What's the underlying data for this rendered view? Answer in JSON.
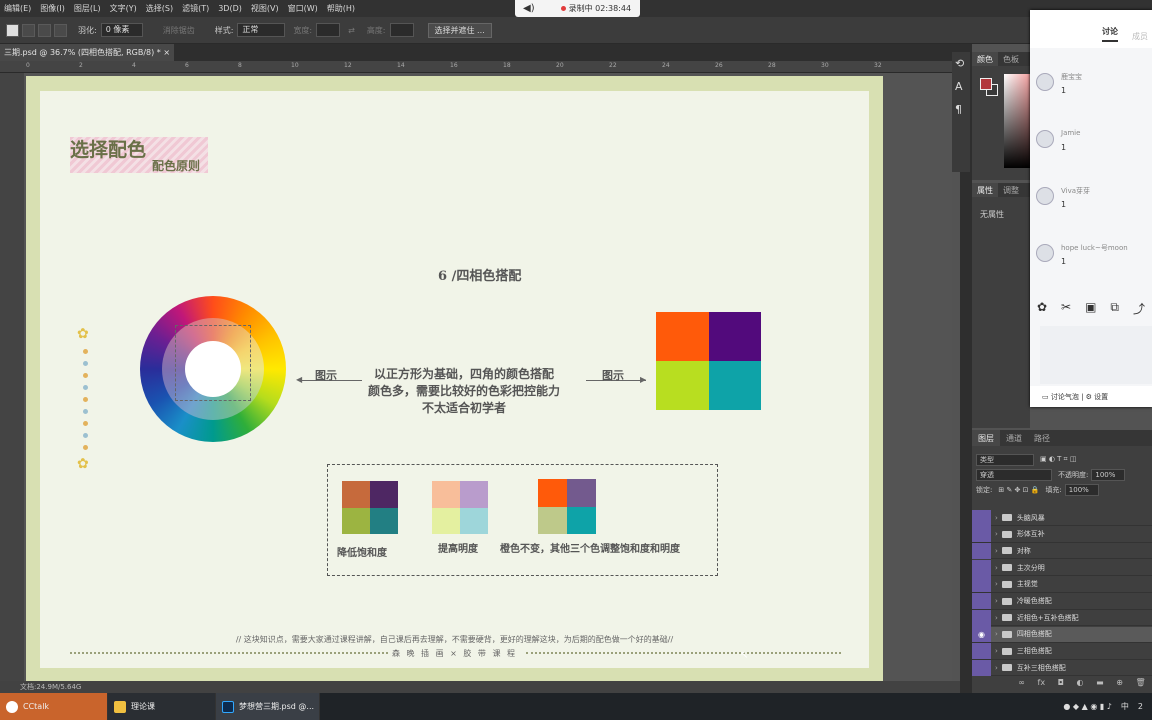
{
  "menu": [
    "编辑(E)",
    "图像(I)",
    "图层(L)",
    "文字(Y)",
    "选择(S)",
    "滤镜(T)",
    "3D(D)",
    "视图(V)",
    "窗口(W)",
    "帮助(H)"
  ],
  "recording": {
    "text": "录制中 02:38:44"
  },
  "options": {
    "feather_label": "羽化:",
    "feather_value": "0 像素",
    "antialias": "消除锯齿",
    "style_label": "样式:",
    "style_value": "正常",
    "width_label": "宽度:",
    "height_label": "高度:",
    "select_mask": "选择并遮住 ..."
  },
  "doc_tab": "三期.psd @ 36.7% (四相色搭配, RGB/8) * ×",
  "ruler": [
    "0",
    "2",
    "4",
    "6",
    "8",
    "10",
    "12",
    "14",
    "16",
    "18",
    "20",
    "22",
    "24",
    "26",
    "28",
    "30",
    "32"
  ],
  "artboard": {
    "title": "选择配色",
    "subtitle": "配色原则",
    "section": "6 /四相色搭配",
    "left_tip": "图示",
    "right_tip": "图示",
    "desc": [
      "以正方形为基础，四角的颜色搭配",
      "颜色多，需要比较好的色彩把控能力",
      "不太适合初学者"
    ],
    "big_colors": [
      "#ff5a0a",
      "#520a7c",
      "#b8de20",
      "#0ea3a8"
    ],
    "swatches": [
      {
        "colors": [
          "#c66a3c",
          "#4e2763",
          "#9cb441",
          "#227f83"
        ],
        "caption": "降低饱和度"
      },
      {
        "colors": [
          "#f8be9a",
          "#b99ccc",
          "#e4f0a0",
          "#9ed6da"
        ],
        "caption": "提高明度"
      },
      {
        "colors": [
          "#ff5a0a",
          "#735a8e",
          "#bec98a",
          "#0ea3a8"
        ],
        "caption": "橙色不变，其他三个色调整饱和度和明度"
      }
    ],
    "foot": "// 这块知识点，需要大家通过课程讲解，自己课后再去理解，不需要硬背，更好的理解这块，为后期的配色做一个好的基础//",
    "brand": "森 晚 插 画 × 胶 带 课 程"
  },
  "status": "文档:24.9M/5.64G",
  "taskbar": {
    "items": [
      "CCtalk",
      "理论课",
      "梦想营三期.psd @..."
    ],
    "ime": "中",
    "time": "2"
  },
  "color_panel": {
    "tabs": [
      "颜色",
      "色板"
    ]
  },
  "prop_panel": {
    "tabs": [
      "属性",
      "调整"
    ],
    "empty": "无属性"
  },
  "chat": {
    "tabs": [
      "讨论",
      "成员"
    ],
    "messages": [
      {
        "name": "鹿宝宝",
        "text": "1"
      },
      {
        "name": "Jamie",
        "text": "1"
      },
      {
        "name": "Viva芽芽",
        "text": "1"
      },
      {
        "name": "hope luck~号moon",
        "text": "1"
      }
    ],
    "footer_left": "讨论气泡",
    "footer_right": "设置"
  },
  "layers": {
    "tabs": [
      "图层",
      "通道",
      "路径"
    ],
    "kind": "类型",
    "blend": "穿透",
    "opacity_label": "不透明度:",
    "opacity": "100%",
    "lock_label": "锁定:",
    "fill_label": "填充:",
    "fill": "100%",
    "items": [
      "头脑风暴",
      "形体互补",
      "对称",
      "主次分明",
      "主视觉",
      "冷暖色搭配",
      "近相色+互补色搭配",
      "四相色搭配",
      "三相色搭配",
      "互补三相色搭配"
    ],
    "selected": "四相色搭配"
  }
}
